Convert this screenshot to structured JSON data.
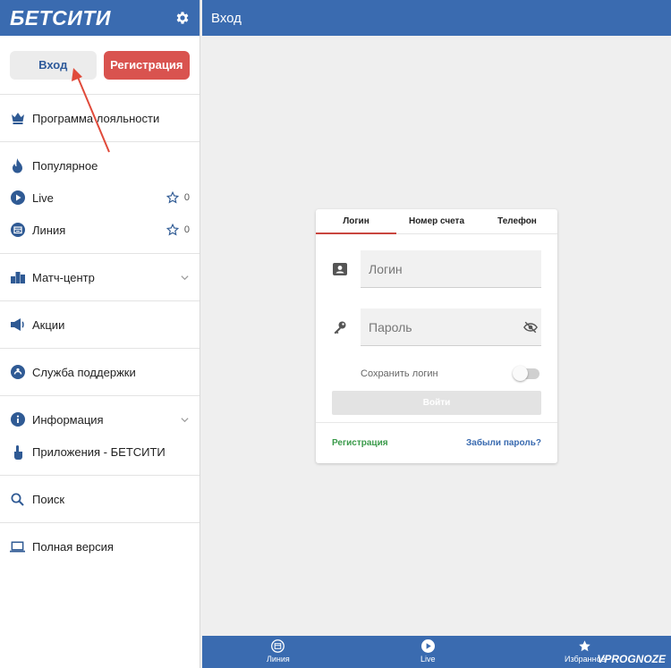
{
  "sidebar": {
    "logo": "БЕТСИТИ",
    "login_button": "Вход",
    "register_button": "Регистрация",
    "items": [
      {
        "label": "Программа лояльности",
        "icon": "crown-icon"
      },
      {
        "label": "Популярное",
        "icon": "flame-icon"
      },
      {
        "label": "Live",
        "icon": "play-icon",
        "fav_count": "0"
      },
      {
        "label": "Линия",
        "icon": "calendar-icon",
        "fav_count": "0"
      },
      {
        "label": "Матч-центр",
        "icon": "podium-icon"
      },
      {
        "label": "Акции",
        "icon": "megaphone-icon"
      },
      {
        "label": "Служба поддержки",
        "icon": "chat-icon"
      },
      {
        "label": "Информация",
        "icon": "info-icon"
      },
      {
        "label": "Приложения - БЕТСИТИ",
        "icon": "tap-icon"
      },
      {
        "label": "Поиск",
        "icon": "search-icon"
      },
      {
        "label": "Полная версия",
        "icon": "laptop-icon"
      }
    ]
  },
  "topbar": {
    "title": "Вход"
  },
  "login_card": {
    "tabs": [
      "Логин",
      "Номер счета",
      "Телефон"
    ],
    "active_tab": "Логин",
    "login_placeholder": "Логин",
    "password_placeholder": "Пароль",
    "save_login_label": "Сохранить логин",
    "save_login_on": false,
    "submit_label": "Войти",
    "register_link": "Регистрация",
    "forgot_link": "Забыли пароль?"
  },
  "bottombar": {
    "items": [
      "Линия",
      "Live",
      "Избранное"
    ],
    "watermark": "VPROGNOZE"
  },
  "colors": {
    "brand_blue": "#3a6bb0",
    "register_red": "#d9534f",
    "accent_green": "#3a9a4a"
  }
}
